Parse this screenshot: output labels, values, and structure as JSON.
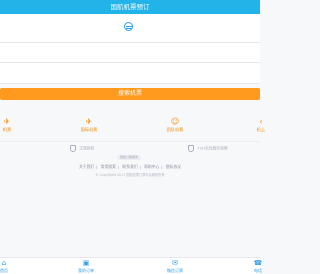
{
  "header": {
    "title": "国航机票预订"
  },
  "search": {
    "button_label": "搜索机票"
  },
  "quick_links": [
    {
      "label": "机票",
      "icon": "plane-ticket-icon"
    },
    {
      "label": "国际机票",
      "icon": "plane-icon"
    },
    {
      "label": "团队机票",
      "icon": "group-icon"
    },
    {
      "label": "机上",
      "icon": "more-icon"
    }
  ],
  "trust": {
    "left": "正规授权",
    "right": "72H无忧服务保障"
  },
  "divider": {
    "label": "国航订票服务"
  },
  "footer_links": [
    "关于我们",
    "常用搜索",
    "联系我们",
    "帮助中心",
    "隐私协议"
  ],
  "copyright": "© CopyRight 2017 国航机票订票平台版权所有",
  "bottom_nav": [
    {
      "label": "首页",
      "icon": "home-icon"
    },
    {
      "label": "我的订单",
      "icon": "order-icon"
    },
    {
      "label": "微信订票",
      "icon": "wechat-icon"
    },
    {
      "label": "电话",
      "icon": "phone-icon"
    }
  ],
  "colors": {
    "header": "#22b3e8",
    "accent": "#ff9a1f",
    "nav": "#2a9ee8"
  }
}
